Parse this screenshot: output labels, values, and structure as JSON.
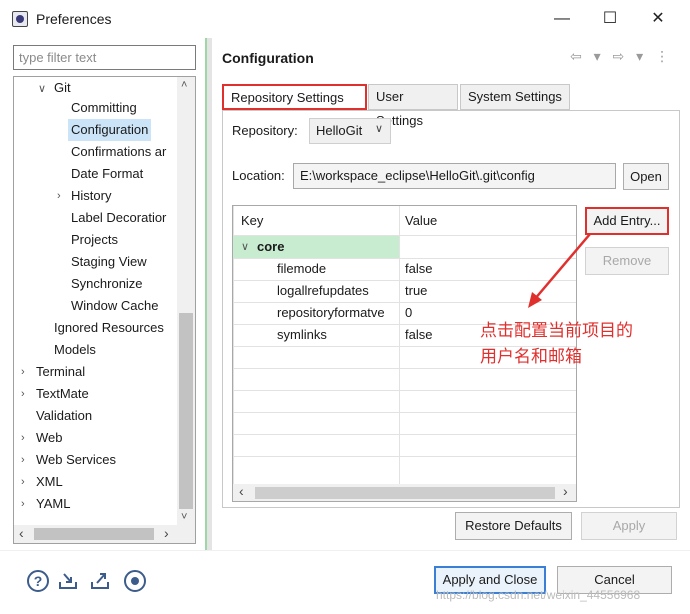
{
  "window": {
    "title": "Preferences",
    "minimize": "—",
    "maximize": "☐",
    "close": "✕"
  },
  "filter": {
    "placeholder": "type filter text"
  },
  "tree": {
    "items": [
      {
        "label": "Git",
        "chevron": "∨"
      },
      {
        "label": "Committing"
      },
      {
        "label": "Configuration"
      },
      {
        "label": "Confirmations ar"
      },
      {
        "label": "Date Format"
      },
      {
        "label": "History",
        "chevron": "›"
      },
      {
        "label": "Label Decoratior"
      },
      {
        "label": "Projects"
      },
      {
        "label": "Staging View"
      },
      {
        "label": "Synchronize"
      },
      {
        "label": "Window Cache"
      },
      {
        "label": "Ignored Resources"
      },
      {
        "label": "Models"
      },
      {
        "label": "Terminal",
        "chevron": "›"
      },
      {
        "label": "TextMate",
        "chevron": "›"
      },
      {
        "label": "Validation"
      },
      {
        "label": "Web",
        "chevron": "›"
      },
      {
        "label": "Web Services",
        "chevron": "›"
      },
      {
        "label": "XML",
        "chevron": "›"
      },
      {
        "label": "YAML",
        "chevron": "›"
      }
    ],
    "selected": "Configuration",
    "scroll_left": "‹",
    "scroll_right": "›",
    "scroll_up": "˄",
    "scroll_down": "˅"
  },
  "page": {
    "title": "Configuration",
    "nav_icons": "⇦ ▾ ⇨ ▾ ⋮",
    "tabs": [
      "Repository Settings",
      "User Settings",
      "System Settings"
    ],
    "repository_label": "Repository:",
    "repository_value": "HelloGit",
    "location_label": "Location:",
    "location_value": "E:\\workspace_eclipse\\HelloGit\\.git\\config",
    "open_label": "Open"
  },
  "table": {
    "headers": [
      "Key",
      "Value"
    ],
    "section": "core",
    "rows": [
      {
        "key": "filemode",
        "value": "false"
      },
      {
        "key": "logallrefupdates",
        "value": "true"
      },
      {
        "key": "repositoryformatve",
        "value": "0"
      },
      {
        "key": "symlinks",
        "value": "false"
      }
    ],
    "scroll_left": "‹",
    "scroll_right": "›"
  },
  "buttons": {
    "add_entry": "Add Entry...",
    "remove": "Remove",
    "restore_defaults": "Restore Defaults",
    "apply": "Apply",
    "apply_and_close": "Apply and Close",
    "cancel": "Cancel"
  },
  "annotation": {
    "line1": "点击配置当前项目的",
    "line2": "用户名和邮箱",
    "color": "#e0302e"
  },
  "watermark": "https://blog.csdn.net/weixin_44556968",
  "footer_icons": [
    "help-icon",
    "import-icon",
    "export-icon",
    "record-icon"
  ]
}
